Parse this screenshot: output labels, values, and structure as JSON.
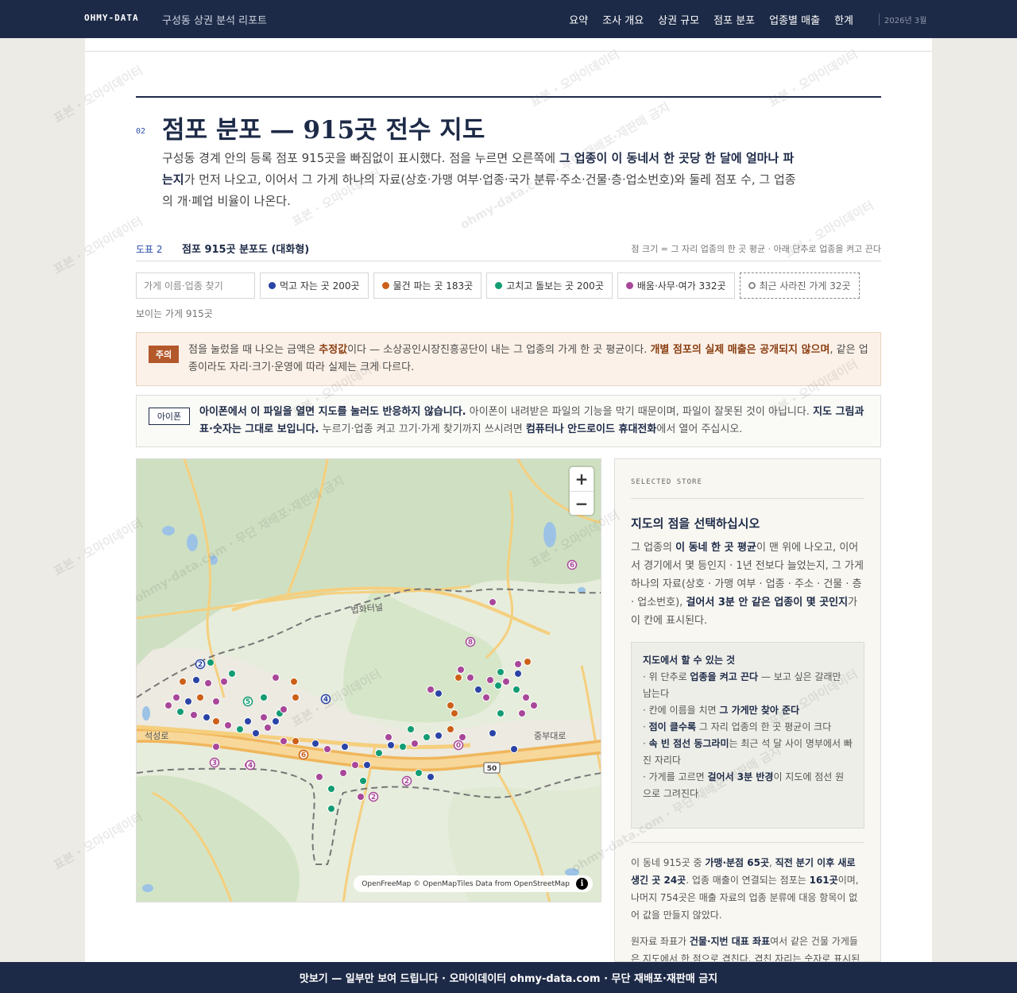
{
  "header": {
    "brand": "OHMY-DATA",
    "report_title": "구성동 상권 분석 리포트",
    "nav": [
      "요약",
      "조사 개요",
      "상권 규모",
      "점포 분포",
      "업종별 매출",
      "한계"
    ],
    "date": "2026년 3월"
  },
  "section": {
    "number": "02",
    "title": "점포 분포 — 915곳 전수 지도",
    "lead_1": "구성동 경계 안의 등록 점포 915곳을 빠짐없이 표시했다. 점을 누르면 오른쪽에 ",
    "lead_bold": "그 업종이 이 동네서 한 곳당 한 달에 얼마나 파는지",
    "lead_2": "가 먼저 나오고, 이어서 그 가게 하나의 자료(상호·가맹 여부·업종·국가 분류·주소·건물·층·업소번호)와 둘레 점포 수, 그 업종의 개·폐업 비율이 나온다."
  },
  "figure": {
    "label": "도표 2",
    "title": "점포 915곳 분포도 (대화형)",
    "note": "점 크기 = 그 자리 업종의 한 곳 평균 · 아래 단추로 업종을 켜고 끈다",
    "search_placeholder": "가게 이름·업종 찾기",
    "visible_count": "보이는 가게 915곳"
  },
  "filters": [
    {
      "label": "먹고 자는 곳 200곳",
      "color": "#2a44a6"
    },
    {
      "label": "물건 파는 곳 183곳",
      "color": "#cc6019"
    },
    {
      "label": "고치고 돌보는 곳 200곳",
      "color": "#139c73"
    },
    {
      "label": "배움·사무·여가 332곳",
      "color": "#a8479a"
    }
  ],
  "filter_closed": {
    "label": "최근 사라진 가게 32곳"
  },
  "warning": {
    "badge": "주의",
    "text_1": "점을 눌렀을 때 나오는 금액은 ",
    "bold_1": "추정값",
    "text_2": "이다 — 소상공인시장진흥공단이 내는 그 업종의 가게 한 곳 평균이다. ",
    "bold_2": "개별 점포의 실제 매출은 공개되지 않으며",
    "text_3": ", 같은 업종이라도 자리·크기·운영에 따라 실제는 크게 다르다."
  },
  "iphone": {
    "badge": "아이폰",
    "bold_1": "아이폰에서 이 파일을 열면 지도를 눌러도 반응하지 않습니다.",
    "text_1": " 아이폰이 내려받은 파일의 기능을 막기 때문이며, 파일이 잘못된 것이 아닙니다. ",
    "bold_2": "지도 그림과 표·숫자는 그대로 보입니다.",
    "text_2": " 누르기·업종 켜고 끄기·가게 찾기까지 쓰시려면 ",
    "bold_3": "컴퓨터나 안드로이드 휴대전화",
    "text_3": "에서 열어 주십시오."
  },
  "map": {
    "zoom_in": "+",
    "zoom_out": "−",
    "attribution": "OpenFreeMap © OpenMapTiles Data from OpenStreetMap",
    "road_1": "법화터널",
    "road_2": "중부대로",
    "road_3": "석성로",
    "road_shield": "50",
    "colors": {
      "land": "#e7eddc",
      "forest": "#cfe0c2",
      "road": "#f5cf7e",
      "highway": "#f0b65c",
      "water": "#9cc3e6",
      "boundary": "#777777"
    }
  },
  "side": {
    "eyebrow": "SELECTED STORE",
    "heading": "지도의 점을 선택하십시오",
    "body_1": "그 업종의 ",
    "body_b1": "이 동네 한 곳 평균",
    "body_2": "이 맨 위에 나오고, 이어서 경기에서 몇 등인지 · 1년 전보다 늘었는지, 그 가게 하나의 자료(상호 · 가맹 여부 · 업종 · 주소 · 건물 · 층 · 업소번호), ",
    "body_b2": "걸어서 3분 안 같은 업종이 몇 곳인지",
    "body_3": "가 이 칸에 표시된다.",
    "howto_title": "지도에서 할 수 있는 것",
    "howto_1a": "· 위 단추로 ",
    "howto_1b": "업종을 켜고 끈다",
    "howto_1c": " — 보고 싶은 갈래만 남는다",
    "howto_2a": "· 칸에 이름을 치면 ",
    "howto_2b": "그 가게만 찾아 준다",
    "howto_3a": "· ",
    "howto_3b": "점이 클수록",
    "howto_3c": " 그 자리 업종의 한 곳 평균이 크다",
    "howto_4a": "· ",
    "howto_4b": "속 빈 점선 동그라미",
    "howto_4c": "는 최근 석 달 사이 명부에서 빠진 자리다",
    "howto_5a": "· 가게를 고르면 ",
    "howto_5b": "걸어서 3분 반경",
    "howto_5c": "이 지도에 점선 원으로 그려진다",
    "stats_1": "이 동네 915곳 중 ",
    "stats_b1": "가맹·분점 65곳",
    "stats_2": ", ",
    "stats_b2": "직전 분기 이후 새로 생긴 곳 24곳",
    "stats_3": ". 업종 매출이 연결되는 점포는 ",
    "stats_b3": "161곳",
    "stats_4": "이며, 나머지 754곳은 매출 자료의 업종 분류에 대응 항목이 없어 값을 만들지 않았다.",
    "geo_1": "원자료 좌표가 ",
    "geo_b1": "건물·지번 대표 좌표",
    "geo_2": "여서 같은 건물 가게들은 지도에서 한 점으로 겹친다. 겹친 자리는 숫자로 표시된다."
  },
  "footer": {
    "text": "맛보기 — 일부만 보여 드립니다 · 오마이데이터 ohmy-data.com · 무단 재배포·재판매 금지"
  },
  "watermark": {
    "text": "표본 · 오마이데이터",
    "text_2": "ohmy-data.com · 무단 재배포·재판매 금지"
  }
}
